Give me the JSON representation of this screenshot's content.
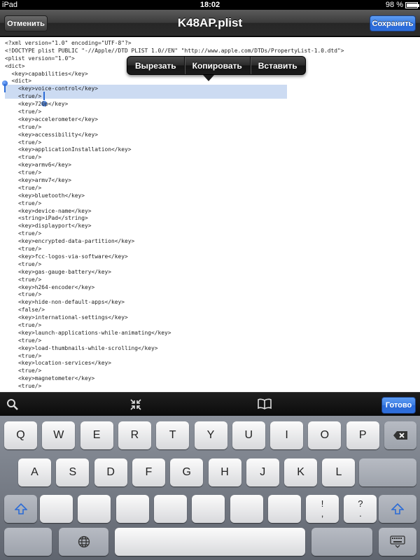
{
  "status_bar": {
    "carrier": "iPad",
    "time": "18:02",
    "battery": "98 %",
    "battery_fraction": 0.98
  },
  "nav": {
    "title": "K48AP.plist",
    "cancel_label": "Отменить",
    "save_label": "Сохранить"
  },
  "edit_menu": {
    "cut": "Вырезать",
    "copy": "Копировать",
    "paste": "Вставить"
  },
  "code_lines": [
    "<?xml version=\"1.0\" encoding=\"UTF-8\"?>",
    "<!DOCTYPE plist PUBLIC \"-//Apple//DTD PLIST 1.0//EN\" \"http://www.apple.com/DTDs/PropertyList-1.0.dtd\">",
    "<plist version=\"1.0\">",
    "<dict>",
    "  <key>capabilities</key>",
    "  <dict>",
    "    <key>voice-control</key>",
    "    <true/>",
    "    <key>720p</key>",
    "    <true/>",
    "    <key>accelerometer</key>",
    "    <true/>",
    "    <key>accessibility</key>",
    "    <true/>",
    "    <key>applicationInstallation</key>",
    "    <true/>",
    "    <key>armv6</key>",
    "    <true/>",
    "    <key>armv7</key>",
    "    <true/>",
    "    <key>bluetooth</key>",
    "    <true/>",
    "    <key>device-name</key>",
    "    <string>iPad</string>",
    "    <key>displayport</key>",
    "    <true/>",
    "    <key>encrypted-data-partition</key>",
    "    <true/>",
    "    <key>fcc-logos-via-software</key>",
    "    <true/>",
    "    <key>gas-gauge-battery</key>",
    "    <true/>",
    "    <key>h264-encoder</key>",
    "    <true/>",
    "    <key>hide-non-default-apps</key>",
    "    <false/>",
    "    <key>international-settings</key>",
    "    <true/>",
    "    <key>launch-applications-while-animating</key>",
    "    <true/>",
    "    <key>load-thumbnails-while-scrolling</key>",
    "    <true/>",
    "    <key>location-services</key>",
    "    <true/>",
    "    <key>magnetometer</key>",
    "    <true/>"
  ],
  "toolbar": {
    "search_icon": "search-icon",
    "collapse_icon": "collapse-icon",
    "bookmarks_icon": "book-icon",
    "done_label": "Готово"
  },
  "keyboard": {
    "row1": [
      "Q",
      "W",
      "E",
      "R",
      "T",
      "Y",
      "U",
      "I",
      "O",
      "P"
    ],
    "row2": [
      "A",
      "S",
      "D",
      "F",
      "G",
      "H",
      "J",
      "K",
      "L"
    ],
    "row3": [
      "Z",
      "X",
      "C",
      "V",
      "B",
      "N",
      "M",
      "!\n,",
      "?\n."
    ],
    "return_label": "return",
    "numbers_label": ".?123",
    "icons": [
      "backspace-icon",
      "shift-icon",
      "globe-icon",
      "keyboard-hide-icon"
    ]
  },
  "colors": {
    "accent_blue": "#2e6fdc",
    "selection": "#a9c3ea"
  }
}
